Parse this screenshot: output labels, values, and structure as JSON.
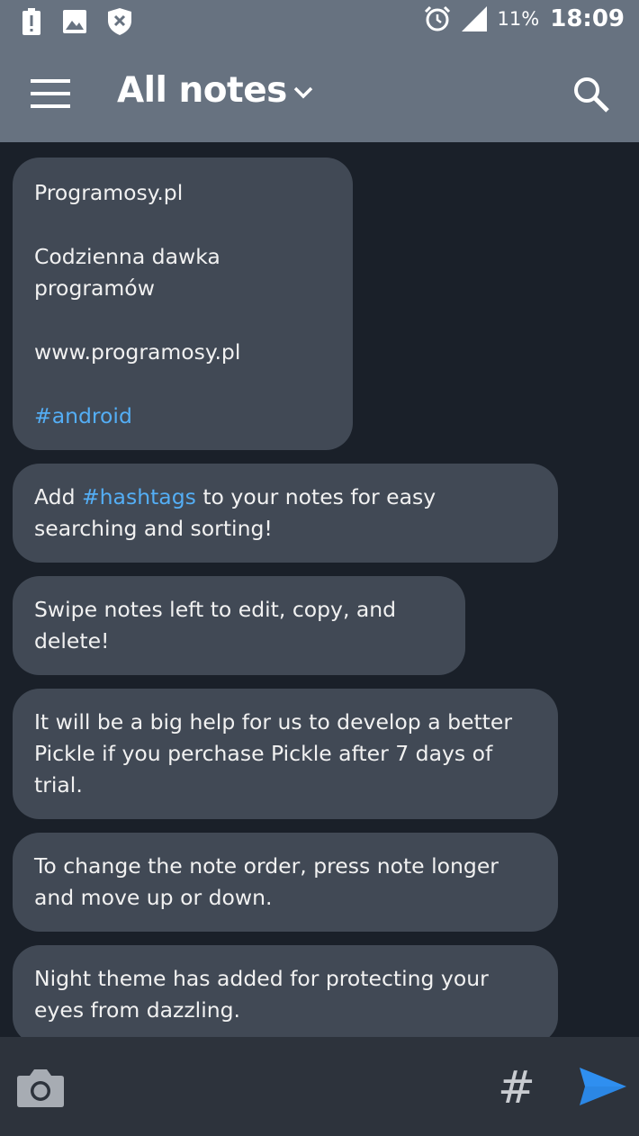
{
  "status_bar": {
    "battery": "11%",
    "time": "18:09",
    "icons": [
      "alert-icon",
      "image-icon",
      "shield-x-icon",
      "alarm-icon",
      "signal-icon"
    ]
  },
  "toolbar": {
    "title": "All notes",
    "icons": [
      "menu-icon",
      "chevron-down-icon",
      "search-icon"
    ]
  },
  "notes": {
    "n1": {
      "line1": "Programosy.pl",
      "line2": "Codzienna dawka programów",
      "line3": "www.programosy.pl",
      "tag": "#android"
    },
    "n2": {
      "pre": "Add ",
      "tag": "#hashtags",
      "post": " to your notes for easy searching and sorting!"
    },
    "n3": {
      "text": "Swipe notes left to edit, copy, and delete!"
    },
    "n4": {
      "text": "It will be a big help for us to develop a better Pickle if you perchase Pickle after 7 days of trial."
    },
    "n5": {
      "text": "To change the note order, press note longer and move up or down."
    },
    "n6": {
      "text": "Night theme has added for protecting your eyes from dazzling."
    }
  },
  "bottom_bar": {
    "hash_label": "#",
    "icons": [
      "camera-icon",
      "hashtag-icon",
      "send-icon"
    ]
  },
  "colors": {
    "header": "#677280",
    "background": "#1a2029",
    "note_bubble": "#414955",
    "hashtag": "#54aef5",
    "send_accent": "#2f8ff0"
  }
}
